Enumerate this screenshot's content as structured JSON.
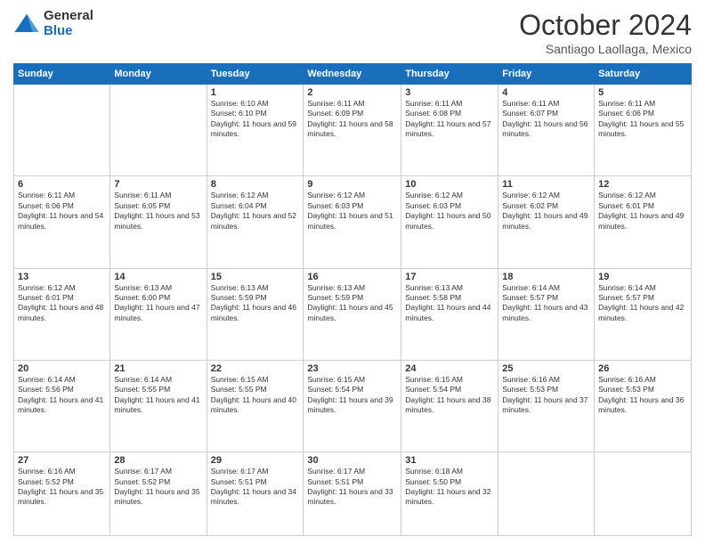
{
  "header": {
    "logo_general": "General",
    "logo_blue": "Blue",
    "month_title": "October 2024",
    "subtitle": "Santiago Laollaga, Mexico"
  },
  "weekdays": [
    "Sunday",
    "Monday",
    "Tuesday",
    "Wednesday",
    "Thursday",
    "Friday",
    "Saturday"
  ],
  "weeks": [
    [
      {
        "day": "",
        "sunrise": "",
        "sunset": "",
        "daylight": ""
      },
      {
        "day": "",
        "sunrise": "",
        "sunset": "",
        "daylight": ""
      },
      {
        "day": "1",
        "sunrise": "Sunrise: 6:10 AM",
        "sunset": "Sunset: 6:10 PM",
        "daylight": "Daylight: 11 hours and 59 minutes."
      },
      {
        "day": "2",
        "sunrise": "Sunrise: 6:11 AM",
        "sunset": "Sunset: 6:09 PM",
        "daylight": "Daylight: 11 hours and 58 minutes."
      },
      {
        "day": "3",
        "sunrise": "Sunrise: 6:11 AM",
        "sunset": "Sunset: 6:08 PM",
        "daylight": "Daylight: 11 hours and 57 minutes."
      },
      {
        "day": "4",
        "sunrise": "Sunrise: 6:11 AM",
        "sunset": "Sunset: 6:07 PM",
        "daylight": "Daylight: 11 hours and 56 minutes."
      },
      {
        "day": "5",
        "sunrise": "Sunrise: 6:11 AM",
        "sunset": "Sunset: 6:06 PM",
        "daylight": "Daylight: 11 hours and 55 minutes."
      }
    ],
    [
      {
        "day": "6",
        "sunrise": "Sunrise: 6:11 AM",
        "sunset": "Sunset: 6:06 PM",
        "daylight": "Daylight: 11 hours and 54 minutes."
      },
      {
        "day": "7",
        "sunrise": "Sunrise: 6:11 AM",
        "sunset": "Sunset: 6:05 PM",
        "daylight": "Daylight: 11 hours and 53 minutes."
      },
      {
        "day": "8",
        "sunrise": "Sunrise: 6:12 AM",
        "sunset": "Sunset: 6:04 PM",
        "daylight": "Daylight: 11 hours and 52 minutes."
      },
      {
        "day": "9",
        "sunrise": "Sunrise: 6:12 AM",
        "sunset": "Sunset: 6:03 PM",
        "daylight": "Daylight: 11 hours and 51 minutes."
      },
      {
        "day": "10",
        "sunrise": "Sunrise: 6:12 AM",
        "sunset": "Sunset: 6:03 PM",
        "daylight": "Daylight: 11 hours and 50 minutes."
      },
      {
        "day": "11",
        "sunrise": "Sunrise: 6:12 AM",
        "sunset": "Sunset: 6:02 PM",
        "daylight": "Daylight: 11 hours and 49 minutes."
      },
      {
        "day": "12",
        "sunrise": "Sunrise: 6:12 AM",
        "sunset": "Sunset: 6:01 PM",
        "daylight": "Daylight: 11 hours and 49 minutes."
      }
    ],
    [
      {
        "day": "13",
        "sunrise": "Sunrise: 6:12 AM",
        "sunset": "Sunset: 6:01 PM",
        "daylight": "Daylight: 11 hours and 48 minutes."
      },
      {
        "day": "14",
        "sunrise": "Sunrise: 6:13 AM",
        "sunset": "Sunset: 6:00 PM",
        "daylight": "Daylight: 11 hours and 47 minutes."
      },
      {
        "day": "15",
        "sunrise": "Sunrise: 6:13 AM",
        "sunset": "Sunset: 5:59 PM",
        "daylight": "Daylight: 11 hours and 46 minutes."
      },
      {
        "day": "16",
        "sunrise": "Sunrise: 6:13 AM",
        "sunset": "Sunset: 5:59 PM",
        "daylight": "Daylight: 11 hours and 45 minutes."
      },
      {
        "day": "17",
        "sunrise": "Sunrise: 6:13 AM",
        "sunset": "Sunset: 5:58 PM",
        "daylight": "Daylight: 11 hours and 44 minutes."
      },
      {
        "day": "18",
        "sunrise": "Sunrise: 6:14 AM",
        "sunset": "Sunset: 5:57 PM",
        "daylight": "Daylight: 11 hours and 43 minutes."
      },
      {
        "day": "19",
        "sunrise": "Sunrise: 6:14 AM",
        "sunset": "Sunset: 5:57 PM",
        "daylight": "Daylight: 11 hours and 42 minutes."
      }
    ],
    [
      {
        "day": "20",
        "sunrise": "Sunrise: 6:14 AM",
        "sunset": "Sunset: 5:56 PM",
        "daylight": "Daylight: 11 hours and 41 minutes."
      },
      {
        "day": "21",
        "sunrise": "Sunrise: 6:14 AM",
        "sunset": "Sunset: 5:55 PM",
        "daylight": "Daylight: 11 hours and 41 minutes."
      },
      {
        "day": "22",
        "sunrise": "Sunrise: 6:15 AM",
        "sunset": "Sunset: 5:55 PM",
        "daylight": "Daylight: 11 hours and 40 minutes."
      },
      {
        "day": "23",
        "sunrise": "Sunrise: 6:15 AM",
        "sunset": "Sunset: 5:54 PM",
        "daylight": "Daylight: 11 hours and 39 minutes."
      },
      {
        "day": "24",
        "sunrise": "Sunrise: 6:15 AM",
        "sunset": "Sunset: 5:54 PM",
        "daylight": "Daylight: 11 hours and 38 minutes."
      },
      {
        "day": "25",
        "sunrise": "Sunrise: 6:16 AM",
        "sunset": "Sunset: 5:53 PM",
        "daylight": "Daylight: 11 hours and 37 minutes."
      },
      {
        "day": "26",
        "sunrise": "Sunrise: 6:16 AM",
        "sunset": "Sunset: 5:53 PM",
        "daylight": "Daylight: 11 hours and 36 minutes."
      }
    ],
    [
      {
        "day": "27",
        "sunrise": "Sunrise: 6:16 AM",
        "sunset": "Sunset: 5:52 PM",
        "daylight": "Daylight: 11 hours and 35 minutes."
      },
      {
        "day": "28",
        "sunrise": "Sunrise: 6:17 AM",
        "sunset": "Sunset: 5:52 PM",
        "daylight": "Daylight: 11 hours and 35 minutes."
      },
      {
        "day": "29",
        "sunrise": "Sunrise: 6:17 AM",
        "sunset": "Sunset: 5:51 PM",
        "daylight": "Daylight: 11 hours and 34 minutes."
      },
      {
        "day": "30",
        "sunrise": "Sunrise: 6:17 AM",
        "sunset": "Sunset: 5:51 PM",
        "daylight": "Daylight: 11 hours and 33 minutes."
      },
      {
        "day": "31",
        "sunrise": "Sunrise: 6:18 AM",
        "sunset": "Sunset: 5:50 PM",
        "daylight": "Daylight: 11 hours and 32 minutes."
      },
      {
        "day": "",
        "sunrise": "",
        "sunset": "",
        "daylight": ""
      },
      {
        "day": "",
        "sunrise": "",
        "sunset": "",
        "daylight": ""
      }
    ]
  ]
}
